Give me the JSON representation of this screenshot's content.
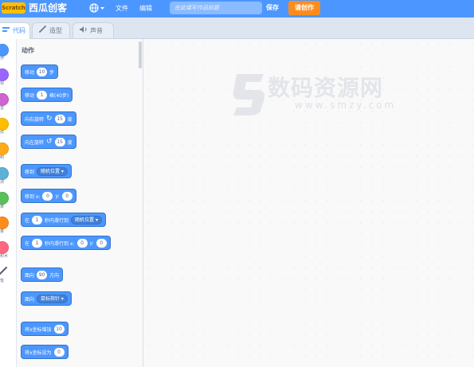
{
  "menubar": {
    "logo_text": "Scratch",
    "brand": "西瓜创客",
    "file_label": "文件",
    "edit_label": "编辑",
    "title_placeholder": "在此填写作品标题",
    "save_label": "保存",
    "create_label": "请创作"
  },
  "tabs": [
    {
      "label": "代码",
      "icon": "code-icon",
      "active": true
    },
    {
      "label": "造型",
      "icon": "brush-icon",
      "active": false
    },
    {
      "label": "声音",
      "icon": "speaker-icon",
      "active": false
    }
  ],
  "categories": [
    {
      "label": "作",
      "color": "#4c97ff"
    },
    {
      "label": "观",
      "color": "#9966ff"
    },
    {
      "label": "音",
      "color": "#cf63cf"
    },
    {
      "label": "件",
      "color": "#ffbf00"
    },
    {
      "label": "制",
      "color": "#ffab19"
    },
    {
      "label": "测",
      "color": "#5cb1d6"
    },
    {
      "label": "算",
      "color": "#59c059"
    },
    {
      "label": "量",
      "color": "#ff8c1a"
    },
    {
      "label": "积木",
      "color": "#ff6680"
    },
    {
      "label": "笔",
      "color": "#0fbd8c"
    }
  ],
  "palette": {
    "section_title": "动作",
    "blocks": [
      {
        "parts": [
          {
            "t": "text",
            "v": "移动"
          },
          {
            "t": "pill",
            "v": "10"
          },
          {
            "t": "text",
            "v": "步"
          }
        ]
      },
      {
        "parts": [
          {
            "t": "text",
            "v": "移动"
          },
          {
            "t": "pill",
            "v": "1"
          },
          {
            "t": "text",
            "v": "格(40步)"
          }
        ]
      },
      {
        "parts": [
          {
            "t": "text",
            "v": "向右旋转"
          },
          {
            "t": "rot",
            "v": "↻"
          },
          {
            "t": "pill",
            "v": "15"
          },
          {
            "t": "text",
            "v": "度"
          }
        ]
      },
      {
        "parts": [
          {
            "t": "text",
            "v": "向左旋转"
          },
          {
            "t": "rot",
            "v": "↺"
          },
          {
            "t": "pill",
            "v": "15"
          },
          {
            "t": "text",
            "v": "度"
          }
        ]
      },
      {
        "parts": [
          {
            "t": "text",
            "v": "移到"
          },
          {
            "t": "drop",
            "v": "随机位置 ▾"
          }
        ]
      },
      {
        "parts": [
          {
            "t": "text",
            "v": "移到 x:"
          },
          {
            "t": "pill",
            "v": "0"
          },
          {
            "t": "text",
            "v": "y:"
          },
          {
            "t": "pill",
            "v": "0"
          }
        ]
      },
      {
        "parts": [
          {
            "t": "text",
            "v": "在"
          },
          {
            "t": "pill",
            "v": "1"
          },
          {
            "t": "text",
            "v": "秒内滑行到"
          },
          {
            "t": "drop",
            "v": "随机位置 ▾"
          }
        ]
      },
      {
        "parts": [
          {
            "t": "text",
            "v": "在"
          },
          {
            "t": "pill",
            "v": "1"
          },
          {
            "t": "text",
            "v": "秒内滑行到 x:"
          },
          {
            "t": "pill",
            "v": "0"
          },
          {
            "t": "text",
            "v": "y:"
          },
          {
            "t": "pill",
            "v": "0"
          }
        ]
      },
      {
        "parts": [
          {
            "t": "text",
            "v": "面向"
          },
          {
            "t": "pill",
            "v": "90"
          },
          {
            "t": "text",
            "v": "方向"
          }
        ]
      },
      {
        "parts": [
          {
            "t": "text",
            "v": "面向"
          },
          {
            "t": "drop",
            "v": "鼠标指针 ▾"
          }
        ]
      },
      {
        "parts": [
          {
            "t": "text",
            "v": "将x坐标增加"
          },
          {
            "t": "pill",
            "v": "10"
          }
        ]
      },
      {
        "parts": [
          {
            "t": "text",
            "v": "将x坐标设为"
          },
          {
            "t": "pill",
            "v": "0"
          }
        ]
      }
    ]
  },
  "watermark": {
    "text": "数码资源网",
    "url": "www.smzy.com"
  }
}
